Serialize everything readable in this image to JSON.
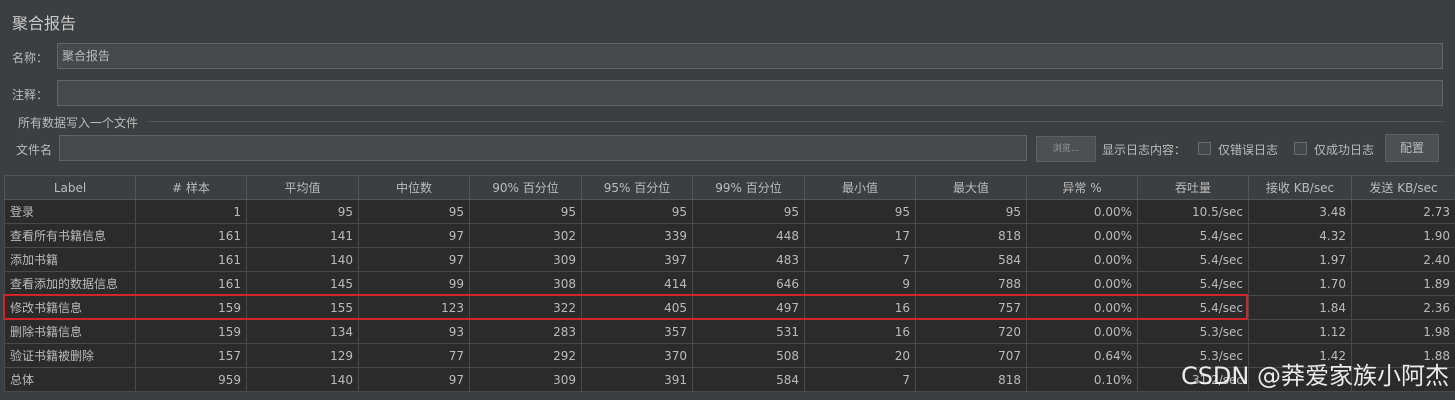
{
  "window": {
    "title": "聚合报告"
  },
  "form": {
    "name_label": "名称：",
    "name_value": "聚合报告",
    "comment_label": "注释：",
    "comment_value": "",
    "section_title": "所有数据写入一个文件",
    "file_label": "文件名",
    "file_value": "",
    "browse_label": "浏览...",
    "log_content_label": "显示日志内容：",
    "errors_only_label": "仅错误日志",
    "success_only_label": "仅成功日志",
    "config_label": "配置"
  },
  "table": {
    "headers": [
      "Label",
      "# 样本",
      "平均值",
      "中位数",
      "90% 百分位",
      "95% 百分位",
      "99% 百分位",
      "最小值",
      "最大值",
      "异常 %",
      "吞吐量",
      "接收 KB/sec",
      "发送 KB/sec"
    ],
    "rows": [
      [
        "登录",
        "1",
        "95",
        "95",
        "95",
        "95",
        "95",
        "95",
        "95",
        "0.00%",
        "10.5/sec",
        "3.48",
        "2.73"
      ],
      [
        "查看所有书籍信息",
        "161",
        "141",
        "97",
        "302",
        "339",
        "448",
        "17",
        "818",
        "0.00%",
        "5.4/sec",
        "4.32",
        "1.90"
      ],
      [
        "添加书籍",
        "161",
        "140",
        "97",
        "309",
        "397",
        "483",
        "7",
        "584",
        "0.00%",
        "5.4/sec",
        "1.97",
        "2.40"
      ],
      [
        "查看添加的数据信息",
        "161",
        "145",
        "99",
        "308",
        "414",
        "646",
        "9",
        "788",
        "0.00%",
        "5.4/sec",
        "1.70",
        "1.89"
      ],
      [
        "修改书籍信息",
        "159",
        "155",
        "123",
        "322",
        "405",
        "497",
        "16",
        "757",
        "0.00%",
        "5.4/sec",
        "1.84",
        "2.36"
      ],
      [
        "删除书籍信息",
        "159",
        "134",
        "93",
        "283",
        "357",
        "531",
        "16",
        "720",
        "0.00%",
        "5.3/sec",
        "1.12",
        "1.98"
      ],
      [
        "验证书籍被删除",
        "157",
        "129",
        "77",
        "292",
        "370",
        "508",
        "20",
        "707",
        "0.64%",
        "5.3/sec",
        "1.42",
        "1.88"
      ],
      [
        "总体",
        "959",
        "140",
        "97",
        "309",
        "391",
        "584",
        "7",
        "818",
        "0.10%",
        "31.2/sec",
        "",
        ""
      ]
    ]
  },
  "watermark": "CSDN @莽爱家族小阿杰",
  "colors": {
    "highlight": "#d0262a",
    "background": "#3c3f41",
    "cell": "#2b2b2b"
  }
}
